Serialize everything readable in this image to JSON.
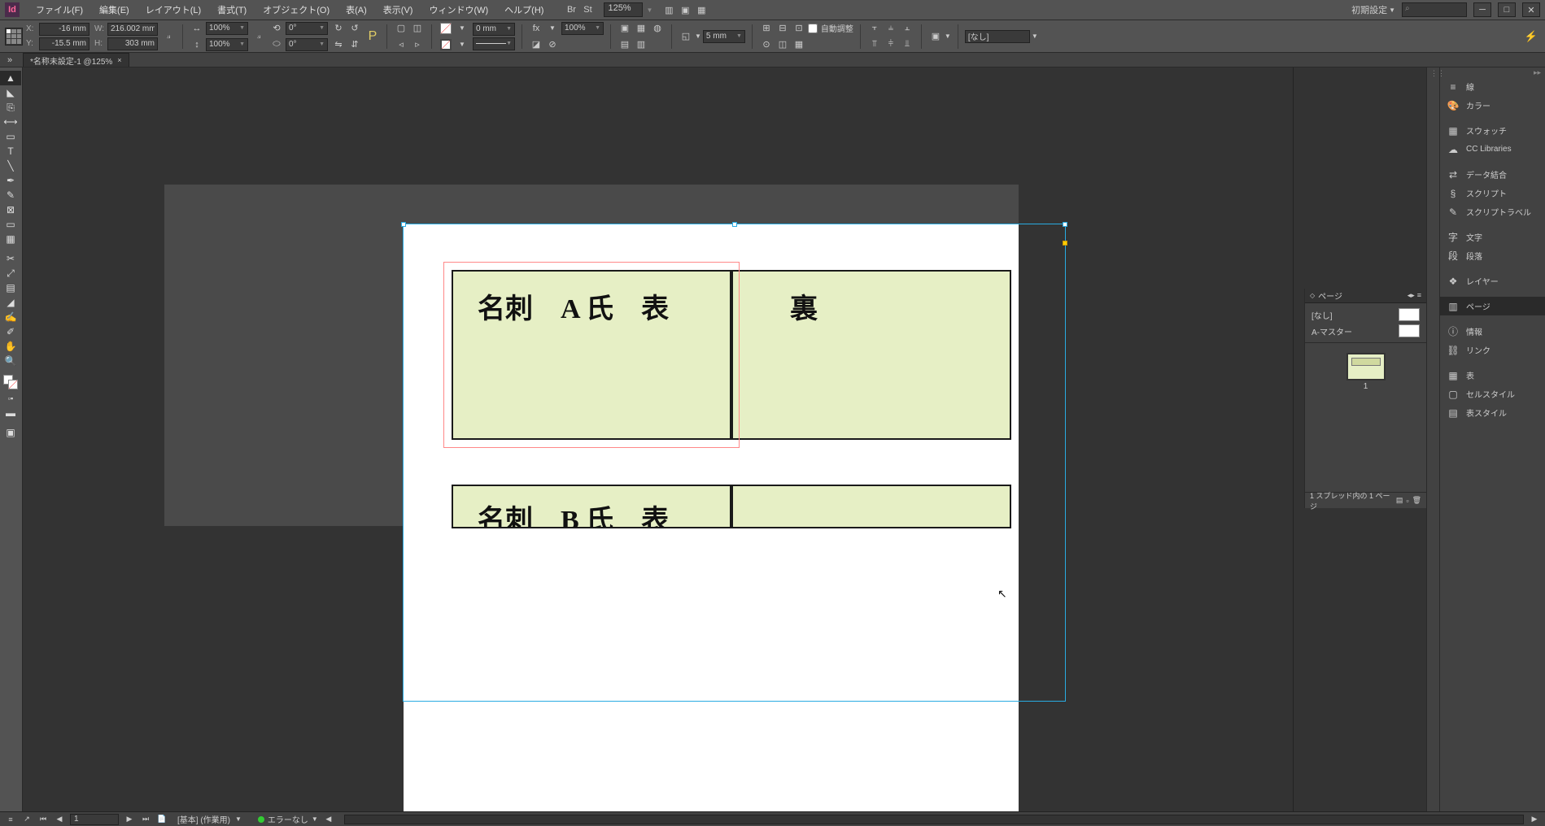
{
  "app": {
    "iconLetters": "Id"
  },
  "menu": {
    "items": [
      "ファイル(F)",
      "編集(E)",
      "レイアウト(L)",
      "書式(T)",
      "オブジェクト(O)",
      "表(A)",
      "表示(V)",
      "ウィンドウ(W)",
      "ヘルプ(H)"
    ],
    "zoom": "125%",
    "workspace": "初期設定"
  },
  "control": {
    "x": "-16 mm",
    "y": "-15.5 mm",
    "w": "216.002 mm",
    "h": "303 mm",
    "scaleW": "100%",
    "scaleH": "100%",
    "rotate": "0°",
    "shear": "0°",
    "rotate2": "0°",
    "strokeW": "0 mm",
    "opacity": "100%",
    "cornerR": "5 mm",
    "autoFit": "自動調整",
    "styleName": "[なし]"
  },
  "tab": {
    "title": "*名称未設定-1 @125%"
  },
  "canvas": {
    "cardA_front": "名刺　A 氏　表",
    "cardA_back": "裏",
    "cardB_front": "名刺　B 氏　表"
  },
  "pagesPanel": {
    "title": "ページ",
    "none": "[なし]",
    "masterA": "A-マスター",
    "pageNum": "1",
    "footer": "1 スプレッド内の 1 ページ"
  },
  "dock": {
    "line": "線",
    "color": "カラー",
    "swatches": "スウォッチ",
    "ccLibs": "CC Libraries",
    "dataMerge": "データ結合",
    "scripts": "スクリプト",
    "scriptLabel": "スクリプトラベル",
    "char": "文字",
    "para": "段落",
    "layers": "レイヤー",
    "pages": "ページ",
    "info": "情報",
    "links": "リンク",
    "table": "表",
    "cellStyle": "セルスタイル",
    "tableStyle": "表スタイル"
  },
  "status": {
    "page": "1",
    "layer": "[基本] (作業用)",
    "preflight": "エラーなし"
  }
}
